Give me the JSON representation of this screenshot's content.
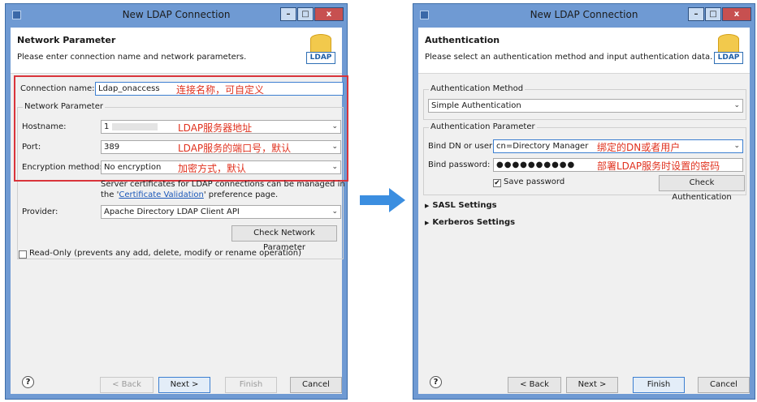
{
  "left_dialog": {
    "title": "New LDAP Connection",
    "header_title": "Network Parameter",
    "header_desc": "Please enter connection name and network parameters.",
    "ldap_badge": "LDAP",
    "connection_name_label": "Connection name:",
    "connection_name_value": "Ldap_onaccess",
    "connection_name_note": "连接名称，可自定义",
    "network_group_title": "Network Parameter",
    "hostname_label": "Hostname:",
    "hostname_value": "1",
    "hostname_note": "LDAP服务器地址",
    "port_label": "Port:",
    "port_value": "389",
    "port_note": "LDAP服务的端口号，默认",
    "encryption_label": "Encryption method:",
    "encryption_value": "No encryption",
    "encryption_note": "加密方式，默认",
    "cert_info_line1": "Server certificates for LDAP connections can be managed in",
    "cert_info_pre": "the '",
    "cert_link": "Certificate Validation",
    "cert_info_post": "' preference page.",
    "provider_label": "Provider:",
    "provider_value": "Apache Directory LDAP Client API",
    "check_network_button": "Check Network Parameter",
    "readonly_label": "Read-Only (prevents any add, delete, modify or rename operation)",
    "back_button": "< Back",
    "next_button": "Next >",
    "finish_button": "Finish",
    "cancel_button": "Cancel"
  },
  "right_dialog": {
    "title": "New LDAP Connection",
    "header_title": "Authentication",
    "header_desc": "Please select an authentication method and input authentication data.",
    "ldap_badge": "LDAP",
    "auth_method_group": "Authentication Method",
    "auth_method_value": "Simple Authentication",
    "auth_param_group": "Authentication Parameter",
    "bind_dn_label": "Bind DN or user:",
    "bind_dn_value": "cn=Directory Manager",
    "bind_dn_note": "绑定的DN或者用户",
    "bind_password_label": "Bind password:",
    "bind_password_value": "●●●●●●●●●●",
    "bind_password_note": "部署LDAP服务时设置的密码",
    "save_password_label": "Save password",
    "save_password_checked": true,
    "check_auth_button": "Check Authentication",
    "sasl_label": "SASL Settings",
    "kerberos_label": "Kerberos Settings",
    "back_button": "< Back",
    "next_button": "Next >",
    "finish_button": "Finish",
    "cancel_button": "Cancel"
  },
  "icons": {
    "window": "window-icon",
    "minimize": "minimize-icon",
    "maximize": "maximize-icon",
    "close": "close-icon",
    "help": "help-icon",
    "flow_arrow": "arrow-right-icon",
    "ldap": "ldap-database-icon"
  },
  "colors": {
    "window_frame": "#6f9ad3",
    "close_button": "#c75050",
    "annotation_red": "#e0311e",
    "annotation_box": "#d9343b",
    "flow_arrow": "#3b8ee0"
  }
}
